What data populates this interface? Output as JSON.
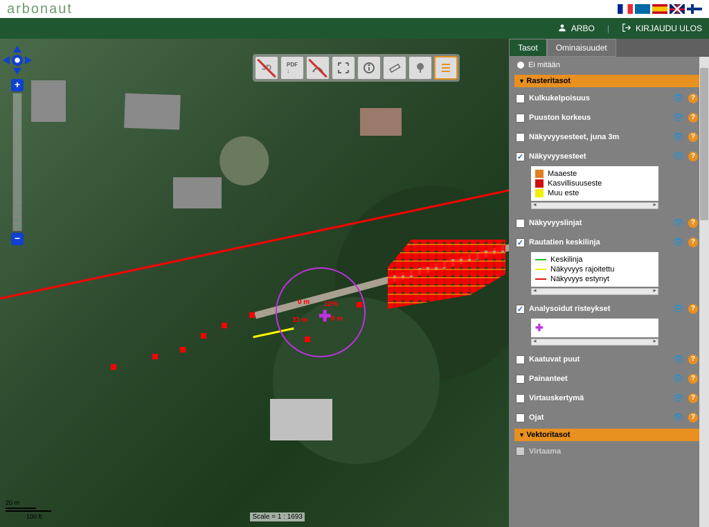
{
  "app": {
    "logo": "arbonaut"
  },
  "header": {
    "user_label": "ARBO",
    "logout_label": "KIRJAUDU ULOS",
    "flags": [
      "fr",
      "se",
      "es",
      "gb",
      "fi"
    ]
  },
  "toolbar": {
    "items": [
      "3d",
      "pdf",
      "path-off",
      "fullscreen",
      "info",
      "measure",
      "tree",
      "legend"
    ]
  },
  "tabs": {
    "active": "Tasot",
    "other": "Ominaisuudet"
  },
  "panel": {
    "radio_none": "Ei mitään",
    "section_raster": "Rasteritasot",
    "section_vector": "Vektoritasot",
    "layers": {
      "kulku": "Kulkukelpoisuus",
      "puusto": "Puuston korkeus",
      "nakyvyys_juna": "Näkyvyysesteet, juna 3m",
      "nakyvyysesteet": "Näkyvyysesteet",
      "nakyvyyslinjat": "Näkyvyyslinjat",
      "rautatien": "Rautatien keskilinja",
      "analysoidut": "Analysoidut risteykset",
      "kaatuvat": "Kaatuvat puut",
      "painanteet": "Painanteet",
      "virtaus": "Virtauskertymä",
      "ojat": "Ojat",
      "virtaama": "Virtaama"
    },
    "legend_obstacle": {
      "maaeste": "Maaeste",
      "kasvi": "Kasvillisuuseste",
      "muu": "Muu este"
    },
    "legend_rail": {
      "keskilinja": "Keskilinja",
      "rajoitettu": "Näkyvyys rajoitettu",
      "estynyt": "Näkyvyys estynyt"
    }
  },
  "map": {
    "label_0m": "0 m",
    "label_33m": "33 m",
    "label_12pct": "12%",
    "label_8m": "8 m",
    "scale_m": "20 m",
    "scale_ft": "100 ft",
    "scale_ratio": "Scale = 1 : 1693"
  }
}
